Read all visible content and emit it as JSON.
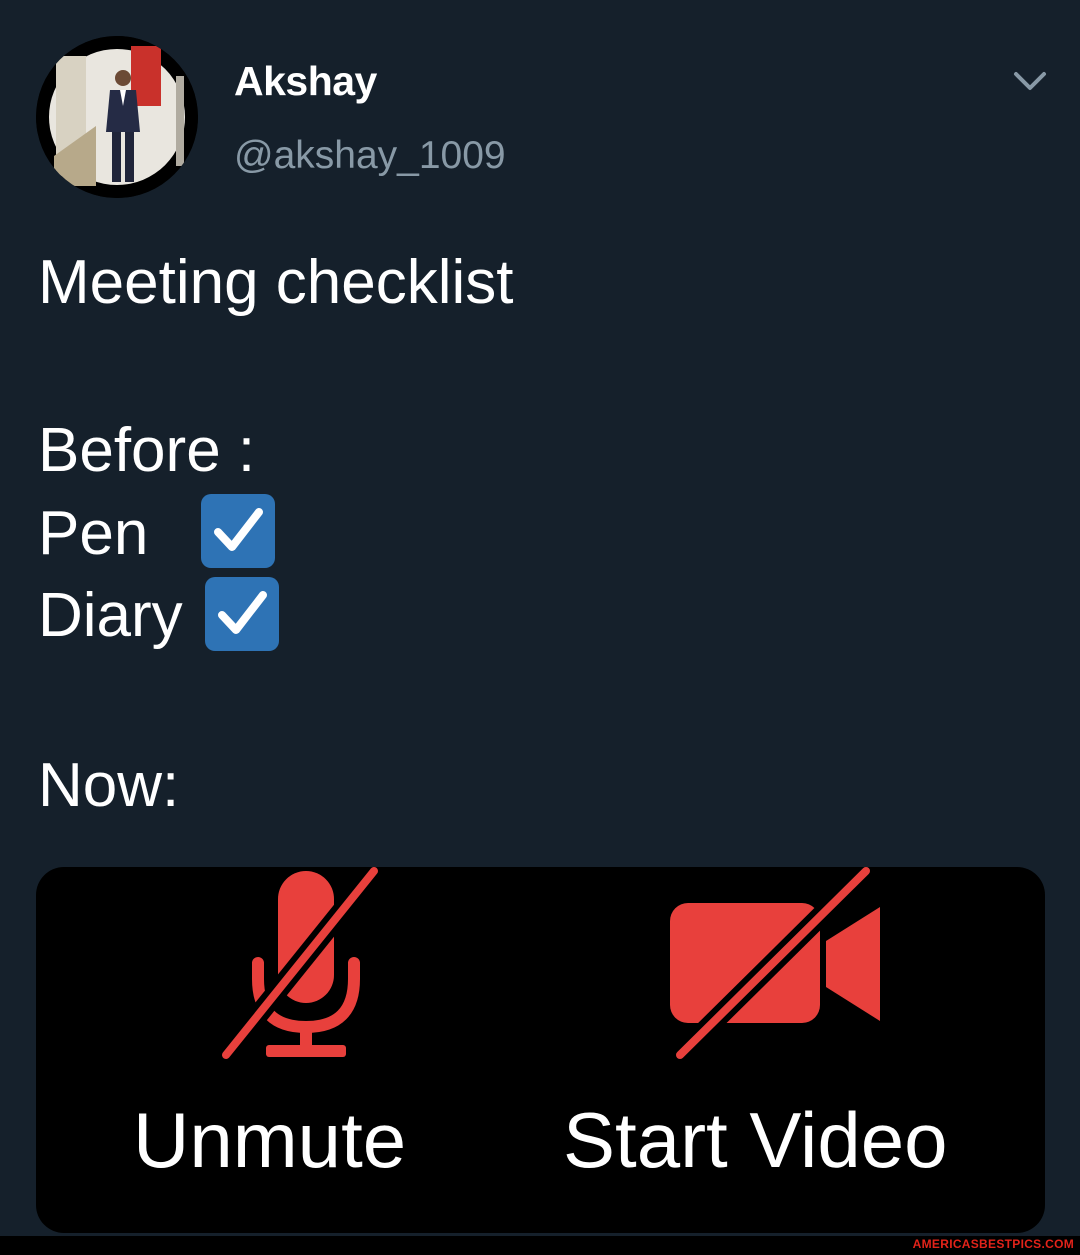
{
  "author": {
    "display_name": "Akshay",
    "handle": "@akshay_1009",
    "avatar_icon": "profile-photo"
  },
  "menu": {
    "icon": "chevron-down-icon"
  },
  "tweet": {
    "title": "Meeting checklist",
    "before_label": "Before :",
    "before_items": [
      {
        "label": "Pen",
        "checked": true
      },
      {
        "label": "Diary",
        "checked": true
      }
    ],
    "now_label": "Now:"
  },
  "media": {
    "mic": {
      "icon": "muted-microphone-icon",
      "label": "Unmute"
    },
    "video": {
      "icon": "video-off-icon",
      "label": "Start Video"
    },
    "icon_color": "#e8403c"
  },
  "watermark": "AMERICASBESTPICS.COM",
  "colors": {
    "background": "#15202b",
    "secondary_text": "#8899a6",
    "checkbox": "#2e73b5",
    "media_background": "#000000"
  }
}
